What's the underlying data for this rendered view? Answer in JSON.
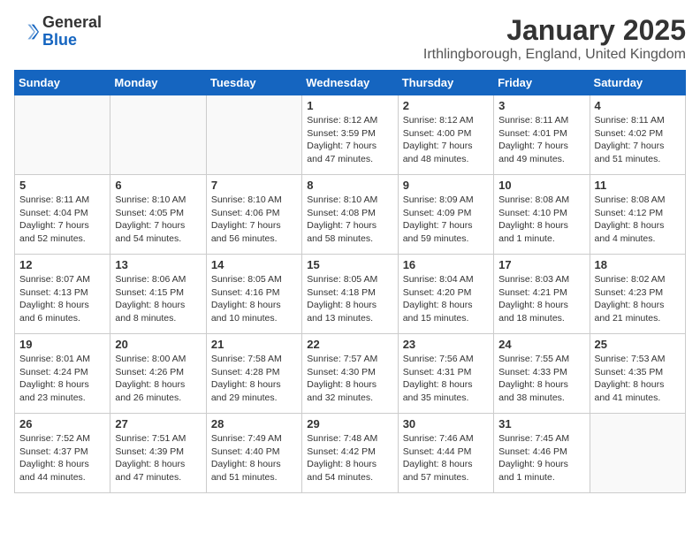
{
  "logo": {
    "general": "General",
    "blue": "Blue"
  },
  "header": {
    "month_year": "January 2025",
    "location": "Irthlingborough, England, United Kingdom"
  },
  "weekdays": [
    "Sunday",
    "Monday",
    "Tuesday",
    "Wednesday",
    "Thursday",
    "Friday",
    "Saturday"
  ],
  "weeks": [
    [
      {
        "day": "",
        "info": ""
      },
      {
        "day": "",
        "info": ""
      },
      {
        "day": "",
        "info": ""
      },
      {
        "day": "1",
        "info": "Sunrise: 8:12 AM\nSunset: 3:59 PM\nDaylight: 7 hours and 47 minutes."
      },
      {
        "day": "2",
        "info": "Sunrise: 8:12 AM\nSunset: 4:00 PM\nDaylight: 7 hours and 48 minutes."
      },
      {
        "day": "3",
        "info": "Sunrise: 8:11 AM\nSunset: 4:01 PM\nDaylight: 7 hours and 49 minutes."
      },
      {
        "day": "4",
        "info": "Sunrise: 8:11 AM\nSunset: 4:02 PM\nDaylight: 7 hours and 51 minutes."
      }
    ],
    [
      {
        "day": "5",
        "info": "Sunrise: 8:11 AM\nSunset: 4:04 PM\nDaylight: 7 hours and 52 minutes."
      },
      {
        "day": "6",
        "info": "Sunrise: 8:10 AM\nSunset: 4:05 PM\nDaylight: 7 hours and 54 minutes."
      },
      {
        "day": "7",
        "info": "Sunrise: 8:10 AM\nSunset: 4:06 PM\nDaylight: 7 hours and 56 minutes."
      },
      {
        "day": "8",
        "info": "Sunrise: 8:10 AM\nSunset: 4:08 PM\nDaylight: 7 hours and 58 minutes."
      },
      {
        "day": "9",
        "info": "Sunrise: 8:09 AM\nSunset: 4:09 PM\nDaylight: 7 hours and 59 minutes."
      },
      {
        "day": "10",
        "info": "Sunrise: 8:08 AM\nSunset: 4:10 PM\nDaylight: 8 hours and 1 minute."
      },
      {
        "day": "11",
        "info": "Sunrise: 8:08 AM\nSunset: 4:12 PM\nDaylight: 8 hours and 4 minutes."
      }
    ],
    [
      {
        "day": "12",
        "info": "Sunrise: 8:07 AM\nSunset: 4:13 PM\nDaylight: 8 hours and 6 minutes."
      },
      {
        "day": "13",
        "info": "Sunrise: 8:06 AM\nSunset: 4:15 PM\nDaylight: 8 hours and 8 minutes."
      },
      {
        "day": "14",
        "info": "Sunrise: 8:05 AM\nSunset: 4:16 PM\nDaylight: 8 hours and 10 minutes."
      },
      {
        "day": "15",
        "info": "Sunrise: 8:05 AM\nSunset: 4:18 PM\nDaylight: 8 hours and 13 minutes."
      },
      {
        "day": "16",
        "info": "Sunrise: 8:04 AM\nSunset: 4:20 PM\nDaylight: 8 hours and 15 minutes."
      },
      {
        "day": "17",
        "info": "Sunrise: 8:03 AM\nSunset: 4:21 PM\nDaylight: 8 hours and 18 minutes."
      },
      {
        "day": "18",
        "info": "Sunrise: 8:02 AM\nSunset: 4:23 PM\nDaylight: 8 hours and 21 minutes."
      }
    ],
    [
      {
        "day": "19",
        "info": "Sunrise: 8:01 AM\nSunset: 4:24 PM\nDaylight: 8 hours and 23 minutes."
      },
      {
        "day": "20",
        "info": "Sunrise: 8:00 AM\nSunset: 4:26 PM\nDaylight: 8 hours and 26 minutes."
      },
      {
        "day": "21",
        "info": "Sunrise: 7:58 AM\nSunset: 4:28 PM\nDaylight: 8 hours and 29 minutes."
      },
      {
        "day": "22",
        "info": "Sunrise: 7:57 AM\nSunset: 4:30 PM\nDaylight: 8 hours and 32 minutes."
      },
      {
        "day": "23",
        "info": "Sunrise: 7:56 AM\nSunset: 4:31 PM\nDaylight: 8 hours and 35 minutes."
      },
      {
        "day": "24",
        "info": "Sunrise: 7:55 AM\nSunset: 4:33 PM\nDaylight: 8 hours and 38 minutes."
      },
      {
        "day": "25",
        "info": "Sunrise: 7:53 AM\nSunset: 4:35 PM\nDaylight: 8 hours and 41 minutes."
      }
    ],
    [
      {
        "day": "26",
        "info": "Sunrise: 7:52 AM\nSunset: 4:37 PM\nDaylight: 8 hours and 44 minutes."
      },
      {
        "day": "27",
        "info": "Sunrise: 7:51 AM\nSunset: 4:39 PM\nDaylight: 8 hours and 47 minutes."
      },
      {
        "day": "28",
        "info": "Sunrise: 7:49 AM\nSunset: 4:40 PM\nDaylight: 8 hours and 51 minutes."
      },
      {
        "day": "29",
        "info": "Sunrise: 7:48 AM\nSunset: 4:42 PM\nDaylight: 8 hours and 54 minutes."
      },
      {
        "day": "30",
        "info": "Sunrise: 7:46 AM\nSunset: 4:44 PM\nDaylight: 8 hours and 57 minutes."
      },
      {
        "day": "31",
        "info": "Sunrise: 7:45 AM\nSunset: 4:46 PM\nDaylight: 9 hours and 1 minute."
      },
      {
        "day": "",
        "info": ""
      }
    ]
  ]
}
